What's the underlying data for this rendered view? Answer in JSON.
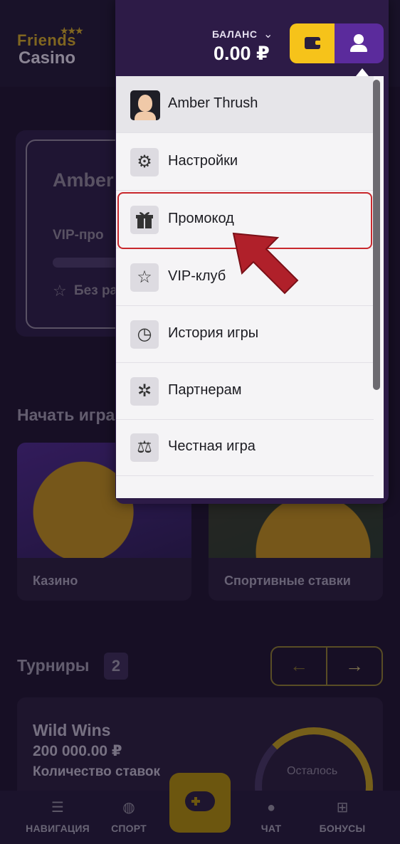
{
  "logo": {
    "line1": "Friends",
    "line2": "Casino",
    "stars": "★★★"
  },
  "profile_card": {
    "name": "Amber",
    "vip": "VIP-про",
    "star": "☆",
    "level": "Без ра"
  },
  "start_section": {
    "title": "Начать игра"
  },
  "game_cards": [
    {
      "caption": "Казино"
    },
    {
      "caption": "Спортивные ставки"
    }
  ],
  "tournaments": {
    "title": "Турниры",
    "count": "2",
    "prev_arrow": "←",
    "next_arrow": "→",
    "card": {
      "name": "Wild Wins",
      "amount": "200 000.00 ₽",
      "label": "Количество ставок",
      "remaining": "Осталось"
    }
  },
  "bottom_nav": {
    "items": [
      {
        "label": "НАВИГАЦИЯ",
        "icon": "search-list-icon"
      },
      {
        "label": "СПОРТ",
        "icon": "basketball-icon"
      },
      {
        "label": "ЧАТ",
        "icon": "chat-icon"
      },
      {
        "label": "БОНУСЫ",
        "icon": "gift-icon"
      }
    ],
    "center_icon": "gamepad-icon"
  },
  "header": {
    "balance_label": "БАЛАНС",
    "balance_value": "0.00 ₽",
    "balance_chevron": "⌄",
    "wallet_icon": "wallet-icon",
    "user_icon": "user-icon"
  },
  "menu": {
    "user_name": "Amber Thrush",
    "items": [
      {
        "label": "Настройки",
        "icon": "gear-icon",
        "glyph": "⚙"
      },
      {
        "label": "Промокод",
        "icon": "gift-icon",
        "glyph": "🎁"
      },
      {
        "label": "VIP-клуб",
        "icon": "star-icon",
        "glyph": "☆"
      },
      {
        "label": "История игры",
        "icon": "clock-icon",
        "glyph": "◷"
      },
      {
        "label": "Партнерам",
        "icon": "network-icon",
        "glyph": "✲"
      },
      {
        "label": "Честная игра",
        "icon": "scales-icon",
        "glyph": "⚖"
      }
    ]
  },
  "colors": {
    "accent_yellow": "#f6c31a",
    "accent_purple": "#5b2b9c",
    "highlight_red": "#c8272c",
    "bg": "#1f1630"
  }
}
